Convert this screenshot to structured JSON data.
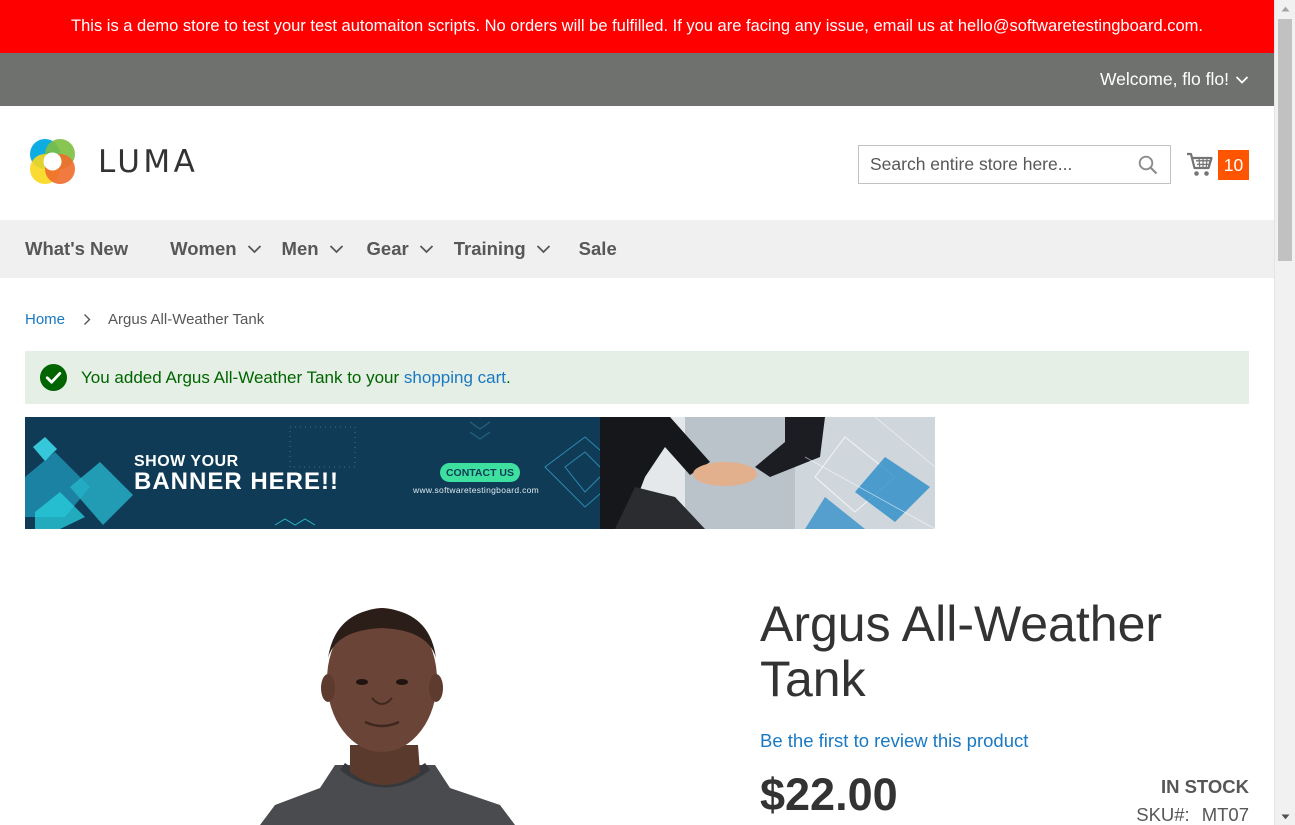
{
  "demo_notice": {
    "text": "This is a demo store to test your test automaiton scripts. No orders will be fulfilled. If you are facing any issue, email us at hello@softwaretestingboard.com."
  },
  "header_panel": {
    "welcome": "Welcome, flo flo!"
  },
  "header": {
    "logo_text": "LUMA",
    "search": {
      "placeholder": "Search entire store here...",
      "value": ""
    },
    "cart": {
      "count": "10"
    }
  },
  "nav": {
    "items": [
      {
        "label": "What's New",
        "has_dropdown": false
      },
      {
        "label": "Women",
        "has_dropdown": true
      },
      {
        "label": "Men",
        "has_dropdown": true
      },
      {
        "label": "Gear",
        "has_dropdown": true
      },
      {
        "label": "Training",
        "has_dropdown": true
      },
      {
        "label": "Sale",
        "has_dropdown": false
      }
    ]
  },
  "breadcrumb": {
    "home": "Home",
    "current": "Argus All-Weather Tank"
  },
  "message": {
    "prefix": "You added Argus All-Weather Tank to your ",
    "link": "shopping cart",
    "suffix": "."
  },
  "banner": {
    "line1": "SHOW YOUR",
    "line2": "BANNER HERE!!",
    "cta": "CONTACT US",
    "url": "www.softwaretestingboard.com"
  },
  "product": {
    "title": "Argus All-Weather Tank",
    "review_link": "Be the first to review this product",
    "price": "$22.00",
    "stock": "IN STOCK",
    "sku_label": "SKU#:",
    "sku": "MT07"
  },
  "colors": {
    "demo_bar": "#ff0000",
    "panel": "#6e716e",
    "link": "#1979c3",
    "cart_badge": "#ff5501",
    "nav_bg": "#f0f0f0",
    "success_bg": "#e5efe5",
    "success_text": "#006400"
  },
  "icons": {
    "search": "search-icon",
    "cart": "cart-icon",
    "check": "check-circle-icon",
    "chevron": "chevron-down-icon"
  }
}
